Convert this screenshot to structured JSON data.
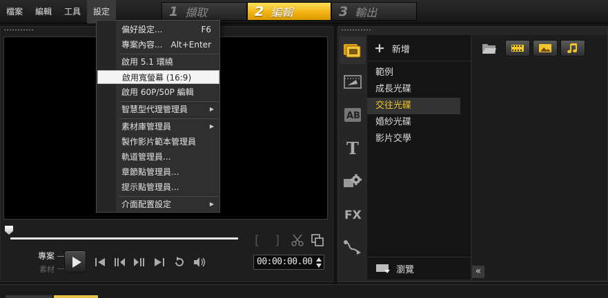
{
  "menubar": [
    {
      "label": "檔案"
    },
    {
      "label": "編輯"
    },
    {
      "label": "工具"
    },
    {
      "label": "設定",
      "active": true
    }
  ],
  "steps": [
    {
      "num": "1",
      "label": "擷取"
    },
    {
      "num": "2",
      "label": "編輯",
      "active": true
    },
    {
      "num": "3",
      "label": "輸出"
    }
  ],
  "settings_menu": {
    "items": [
      {
        "label": "偏好設定...",
        "shortcut": "F6"
      },
      {
        "label": "專案內容...",
        "shortcut": "Alt+Enter"
      },
      {
        "label": "啟用 5.1 環繞"
      },
      {
        "label": "啟用寬螢幕 (16:9)",
        "highlighted": true
      },
      {
        "label": "啟用 60P/50P 編輯"
      },
      {
        "label": "智慧型代理管理員",
        "submenu": true
      },
      {
        "label": "素材庫管理員",
        "submenu": true
      },
      {
        "label": "製作影片範本管理員"
      },
      {
        "label": "軌道管理員..."
      },
      {
        "label": "章節點管理員..."
      },
      {
        "label": "提示點管理員..."
      },
      {
        "label": "介面配置設定",
        "submenu": true
      }
    ],
    "submenu_arrow": "▶"
  },
  "player": {
    "mode_project": "專案",
    "mode_clip": "素材",
    "timecode": "00:00:00.00",
    "trim_in": "[",
    "trim_out": "]"
  },
  "library": {
    "add_label": "新增",
    "folders": [
      {
        "label": "範例"
      },
      {
        "label": "成長光碟"
      },
      {
        "label": "交往光碟",
        "selected": true
      },
      {
        "label": "婚紗光碟"
      },
      {
        "label": "影片交學"
      }
    ],
    "browse_label": "瀏覽",
    "collapse_glyph": "«",
    "sidebar_tabs": [
      "media-icon",
      "transition-icon",
      "title-ab-icon",
      "text-t-icon",
      "filter-gear-icon",
      "fx-icon",
      "path-icon"
    ],
    "fx_label": "FX",
    "ab_label": "AB",
    "t_label": "T"
  },
  "colors": {
    "accent_gold": "#f0b010",
    "selected_text": "#f2c62a",
    "background": "#141414"
  }
}
